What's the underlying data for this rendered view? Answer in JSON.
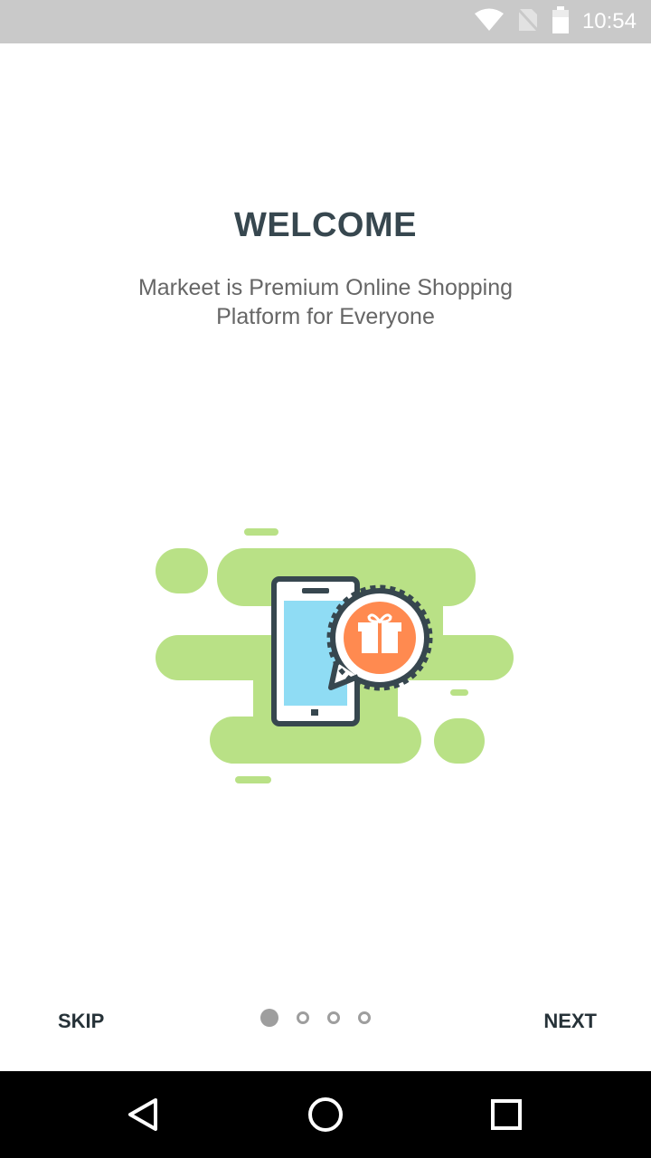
{
  "status_bar": {
    "time": "10:54",
    "icons": [
      "wifi-icon",
      "no-sim-icon",
      "battery-icon"
    ]
  },
  "onboarding": {
    "title": "WELCOME",
    "subtitle": "Markeet is Premium Online Shopping Platform for Everyone",
    "illustration": "phone-gift-icon"
  },
  "pager": {
    "skip_label": "SKIP",
    "next_label": "NEXT",
    "page_count": 4,
    "current_page": 1
  },
  "navigation": {
    "buttons": [
      "back-icon",
      "home-icon",
      "recents-icon"
    ]
  },
  "colors": {
    "status_bar": "#c9c9c9",
    "title": "#37474f",
    "blob_green": "#b9e186",
    "phone_screen": "#8fdcf4",
    "gift_orange": "#ff8a50",
    "outline": "#37474f"
  }
}
